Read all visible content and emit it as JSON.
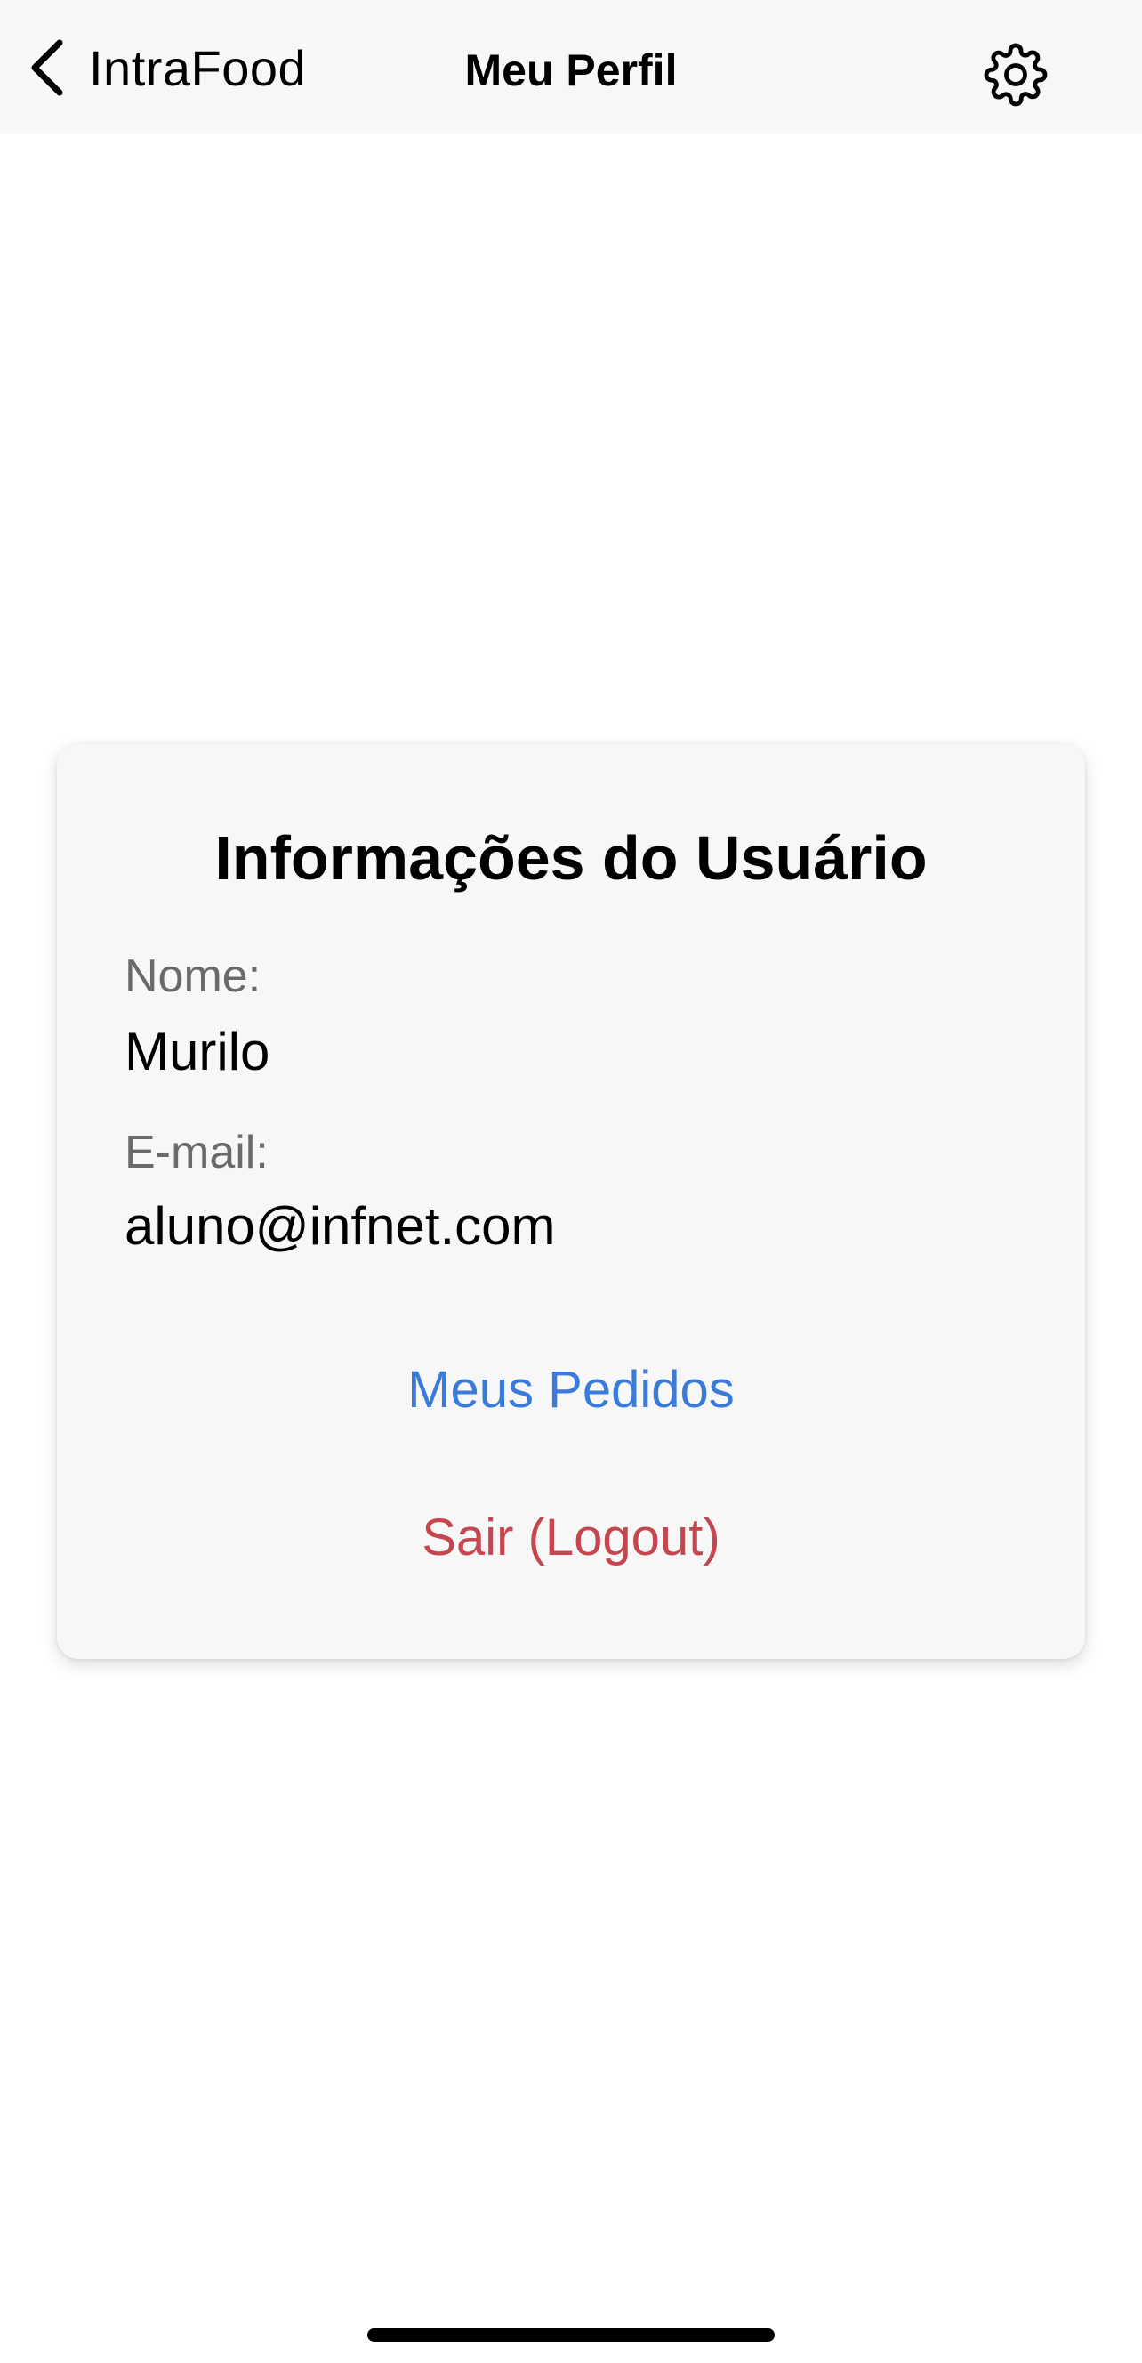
{
  "navbar": {
    "back_label": "IntraFood",
    "title": "Meu Perfil",
    "back_icon": "chevron-left-icon",
    "settings_icon": "gear-icon"
  },
  "profile": {
    "title": "Informações do Usuário",
    "name_label": "Nome:",
    "name_value": "Murilo",
    "email_label": "E-mail:",
    "email_value": "aluno@infnet.com"
  },
  "actions": {
    "orders_label": "Meus Pedidos",
    "logout_label": "Sair (Logout)"
  },
  "colors": {
    "navbar_bg": "#f7f7f7",
    "card_bg": "#f7f7f7",
    "link_blue": "#3a7bd9",
    "logout_red": "#c6464f",
    "label_gray": "#6a6a6a"
  }
}
